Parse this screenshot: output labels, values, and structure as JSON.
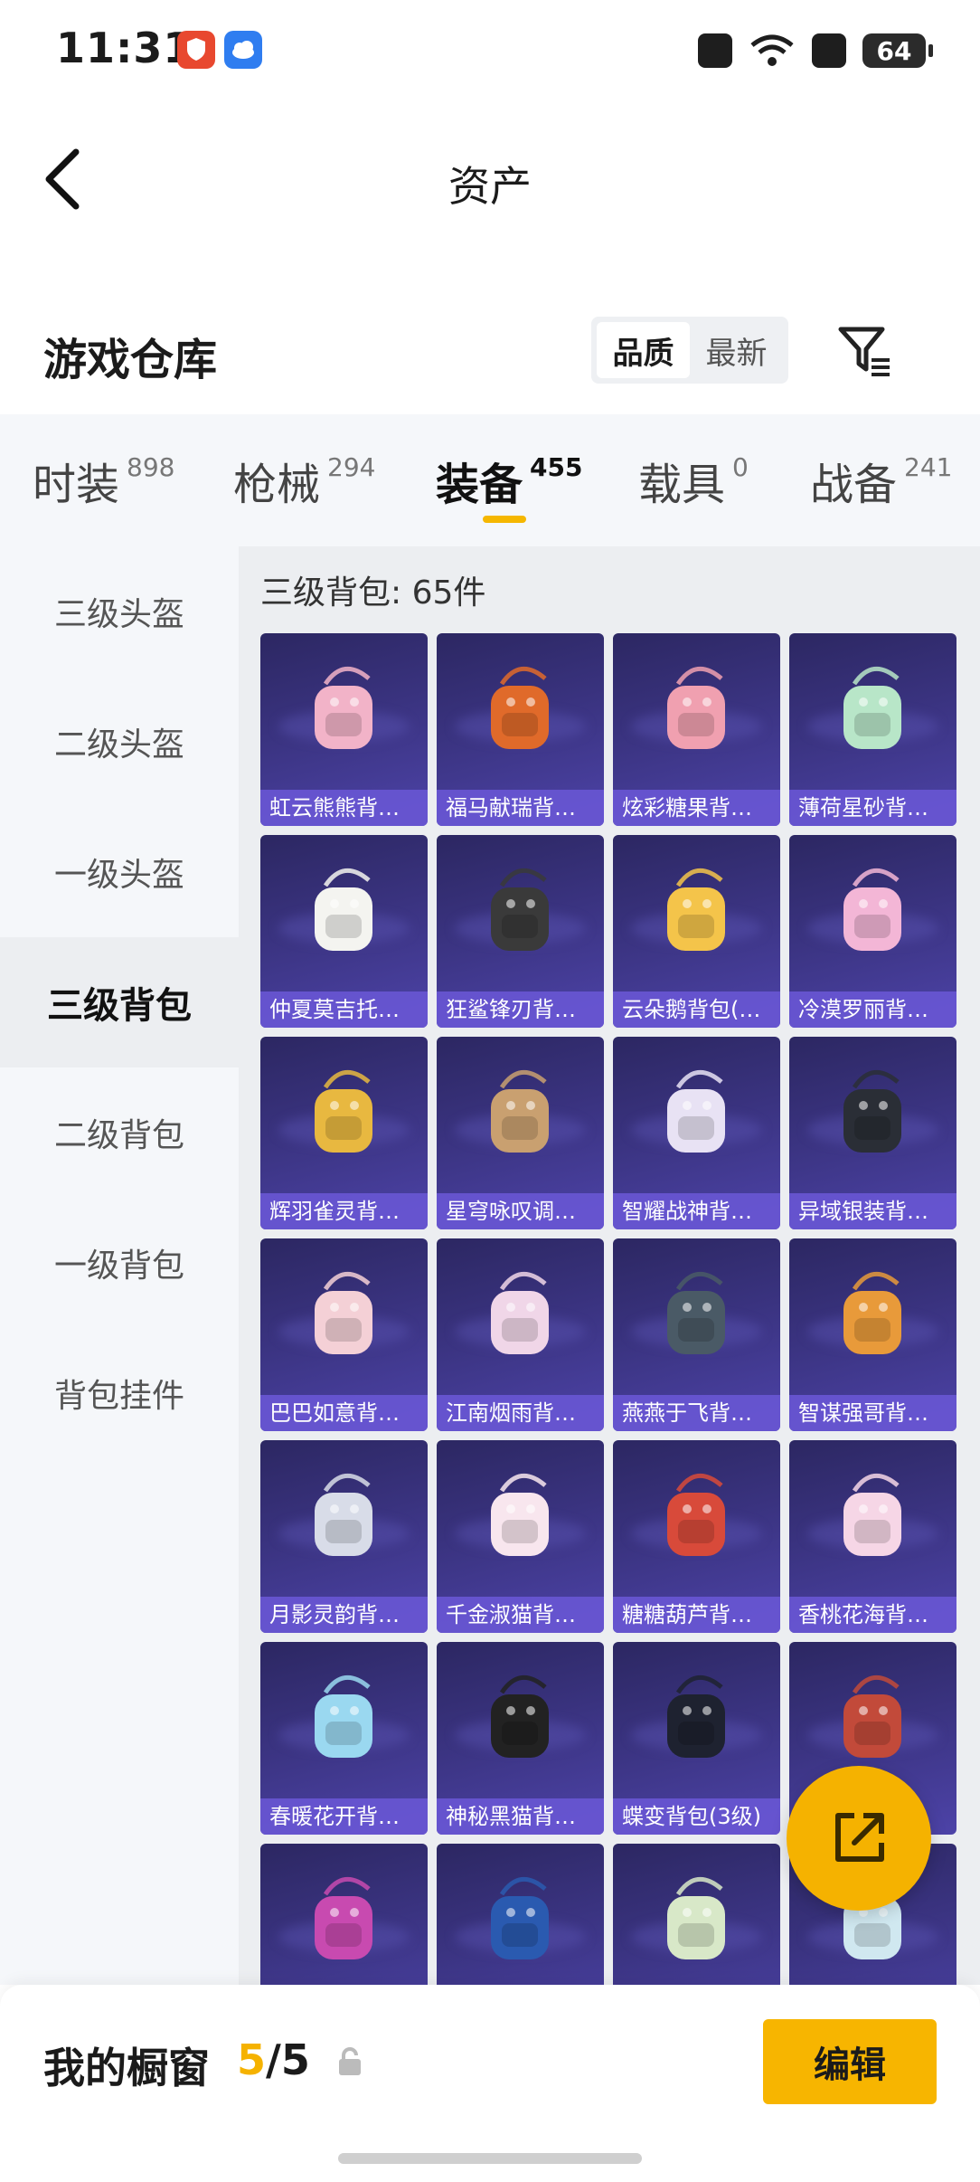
{
  "status_bar": {
    "time": "11:31",
    "battery": "64"
  },
  "nav": {
    "title": "资产"
  },
  "header": {
    "title": "游戏仓库",
    "sort_options": [
      "品质",
      "最新"
    ],
    "active_sort": "品质"
  },
  "tabs": [
    {
      "label": "时装",
      "count": "898"
    },
    {
      "label": "枪械",
      "count": "294"
    },
    {
      "label": "装备",
      "count": "455"
    },
    {
      "label": "载具",
      "count": "0"
    },
    {
      "label": "战备",
      "count": "241"
    }
  ],
  "active_tab": "装备",
  "sidebar": {
    "items": [
      "三级头盔",
      "二级头盔",
      "一级头盔",
      "三级背包",
      "二级背包",
      "一级背包",
      "背包挂件"
    ],
    "active": "三级背包"
  },
  "content": {
    "title": "三级背包: 65件",
    "items": [
      "虹云熊熊背…",
      "福马献瑞背…",
      "炫彩糖果背…",
      "薄荷星砂背…",
      "仲夏莫吉托…",
      "狂鲨锋刃背…",
      "云朵鹅背包(…",
      "冷漠罗丽背…",
      "辉羽雀灵背…",
      "星穹咏叹调…",
      "智耀战神背…",
      "异域银装背…",
      "巴巴如意背…",
      "江南烟雨背…",
      "燕燕于飞背…",
      "智谋强哥背…",
      "月影灵韵背…",
      "千金淑猫背…",
      "糖糖葫芦背…",
      "香桃花海背…",
      "春暖花开背…",
      "神秘黑猫背…",
      "蝶变背包(3级)",
      "",
      "",
      "",
      "",
      ""
    ],
    "item_colors": [
      "#f2b3c8",
      "#e06a2a",
      "#f0a0b0",
      "#b8e6c8",
      "#f4f4f0",
      "#3a3a3a",
      "#f4c44a",
      "#f3b6d6",
      "#e8b840",
      "#c9a070",
      "#e8e2f4",
      "#2a2e36",
      "#f4d0d6",
      "#f0d6e8",
      "#4a5a66",
      "#e89a3a",
      "#d8dce8",
      "#f8e6ee",
      "#d84a3a",
      "#f6d6e6",
      "#9ad8f0",
      "#222222",
      "#1e2230",
      "#c24a3a",
      "#c84ab0",
      "#2a5ab0",
      "#d8e8c8",
      "#d0e8f0"
    ]
  },
  "share_button": {
    "icon": "share-icon"
  },
  "bottom_bar": {
    "label": "我的橱窗",
    "current": "5",
    "separator": "/",
    "total": "5",
    "edit_label": "编辑"
  },
  "colors": {
    "accent": "#f5b200",
    "card_label_bg": "#6856d2"
  }
}
